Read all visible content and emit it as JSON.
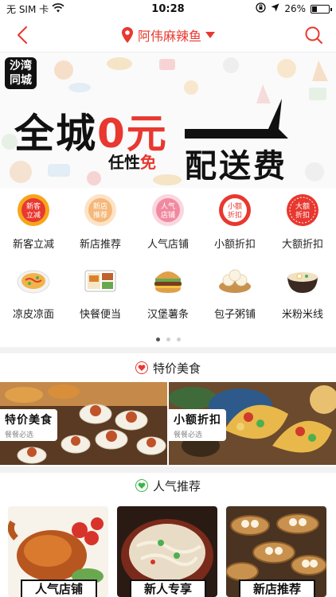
{
  "status_bar": {
    "carrier": "无 SIM 卡",
    "time": "10:28",
    "battery": "26%"
  },
  "nav": {
    "location": "阿伟麻辣鱼",
    "back_icon": "chevron-left-icon",
    "search_icon": "search-icon",
    "accent": "#e8382f"
  },
  "banner": {
    "badge_line1": "沙湾",
    "badge_line2": "同城",
    "headline_pre": "全城",
    "headline_red": "0元",
    "sub_left_pre": "任性",
    "sub_left_red": "免",
    "sub_right": "配送费"
  },
  "categories": [
    {
      "label": "新客立减",
      "icon_text": "新客\n立减",
      "color": "#f7a51b"
    },
    {
      "label": "新店推荐",
      "icon_text": "新店\n推荐",
      "color": "#f5b87a"
    },
    {
      "label": "人气店铺",
      "icon_text": "人气\n店铺",
      "color": "#f08aa0"
    },
    {
      "label": "小额折扣",
      "icon_text": "小额\n折扣",
      "color": "#e8382f"
    },
    {
      "label": "大额折扣",
      "icon_text": "大额\n折扣",
      "color": "#e8382f"
    },
    {
      "label": "凉皮凉面",
      "icon_name": "noodle-plate-icon"
    },
    {
      "label": "快餐便当",
      "icon_name": "bento-box-icon"
    },
    {
      "label": "汉堡薯条",
      "icon_name": "burger-icon"
    },
    {
      "label": "包子粥铺",
      "icon_name": "steamed-bun-icon"
    },
    {
      "label": "米粉米线",
      "icon_name": "noodle-bowl-icon"
    }
  ],
  "sections": {
    "special": "特价美食",
    "popular": "人气推荐"
  },
  "promos": [
    {
      "title": "特价美食",
      "subtitle": "餐餐必选"
    },
    {
      "title": "小额折扣",
      "subtitle": "餐餐必选"
    }
  ],
  "recommendations": [
    {
      "title": "人气店铺"
    },
    {
      "title": "新人专享"
    },
    {
      "title": "新店推荐"
    }
  ]
}
